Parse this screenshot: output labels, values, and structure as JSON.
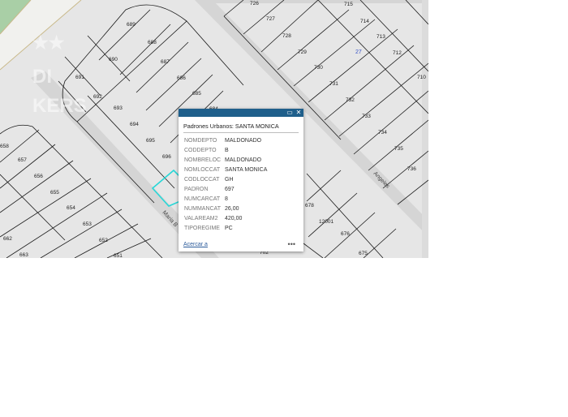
{
  "map": {
    "parcels": [
      "689",
      "688",
      "687",
      "686",
      "685",
      "690",
      "691",
      "692",
      "693",
      "694",
      "695",
      "696",
      "684",
      "726",
      "727",
      "728",
      "729",
      "730",
      "731",
      "732",
      "733",
      "734",
      "735",
      "736",
      "710",
      "712",
      "713",
      "714",
      "715",
      "658",
      "657",
      "656",
      "655",
      "654",
      "653",
      "652",
      "651",
      "662",
      "663",
      "678",
      "12001",
      "676",
      "675",
      "702"
    ],
    "road_labels": [
      "Maria B",
      "Angeles"
    ],
    "block_number": "27",
    "colors": {
      "background": "#e3e3e3",
      "parcel_line": "#1a1a1a",
      "road": "#d2d2d2",
      "selection": "#28d7d7",
      "park": "#a9cfa6",
      "blue_label": "#3a56c8"
    }
  },
  "popup": {
    "title": "Padrones Urbanos: SANTA MONICA",
    "fields": [
      {
        "key": "NOMDEPTO",
        "value": "MALDONADO"
      },
      {
        "key": "CODDEPTO",
        "value": "B"
      },
      {
        "key": "NOMBRELOC",
        "value": "MALDONADO"
      },
      {
        "key": "NOMLOCCAT",
        "value": "SANTA MONICA"
      },
      {
        "key": "CODLOCCAT",
        "value": "GH"
      },
      {
        "key": "PADRON",
        "value": "697"
      },
      {
        "key": "NUMCARCAT",
        "value": "8"
      },
      {
        "key": "NUMMANCAT",
        "value": "26,00"
      },
      {
        "key": "VALAREAM2",
        "value": "420,00"
      },
      {
        "key": "TIPOREGIME",
        "value": "PC"
      }
    ],
    "zoom_label": "Acercar a",
    "more_label": "•••",
    "maximize_icon": "maximize-icon",
    "close_icon": "close-icon"
  }
}
